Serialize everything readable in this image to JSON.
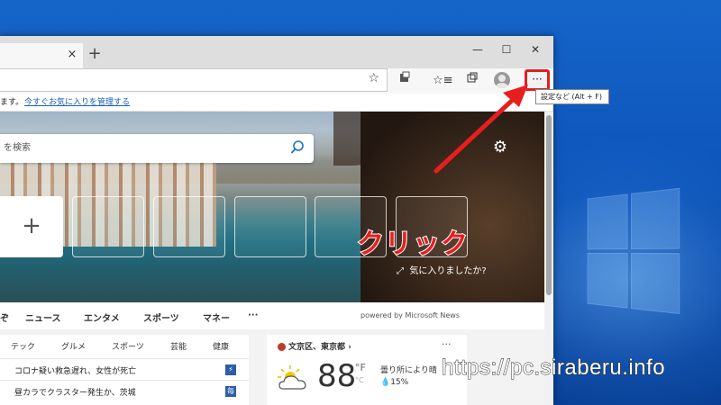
{
  "tab": {
    "close": "×",
    "new": "+"
  },
  "window_controls": {
    "minimize": "—",
    "maximize": "☐",
    "close": "✕"
  },
  "toolbar": {
    "more_label": "···"
  },
  "favbar": {
    "text": "ます。",
    "link": "今すぐお気に入りを管理する"
  },
  "tooltip": "設定など (Alt + F)",
  "hero": {
    "search_placeholder": "を検索",
    "add_tile": "+",
    "favorite_question": "気に入りましたか?"
  },
  "annotation": {
    "click_label": "クリック",
    "color": "#e81e1e"
  },
  "news_nav": {
    "items": [
      "ぞ",
      "ニュース",
      "エンタメ",
      "スポーツ",
      "マネー",
      "···"
    ],
    "powered": "powered by Microsoft News"
  },
  "news": {
    "categories": [
      "テック",
      "グルメ",
      "スポーツ",
      "芸能",
      "健康"
    ],
    "headlines": [
      {
        "text": "コロナ疑い救急遅れ、女性が死亡",
        "source_icon": "⚡"
      },
      {
        "text": "昼カラでクラスター発生か、茨城",
        "source_icon": "毎"
      }
    ]
  },
  "weather": {
    "location": "文京区、東京都 ›",
    "more": "···",
    "temp": "88",
    "unit_f": "°F",
    "unit_c": "°C",
    "condition": "曇り所により晴",
    "precip": "💧15%"
  },
  "watermark": "https://pc.siraberu.info"
}
